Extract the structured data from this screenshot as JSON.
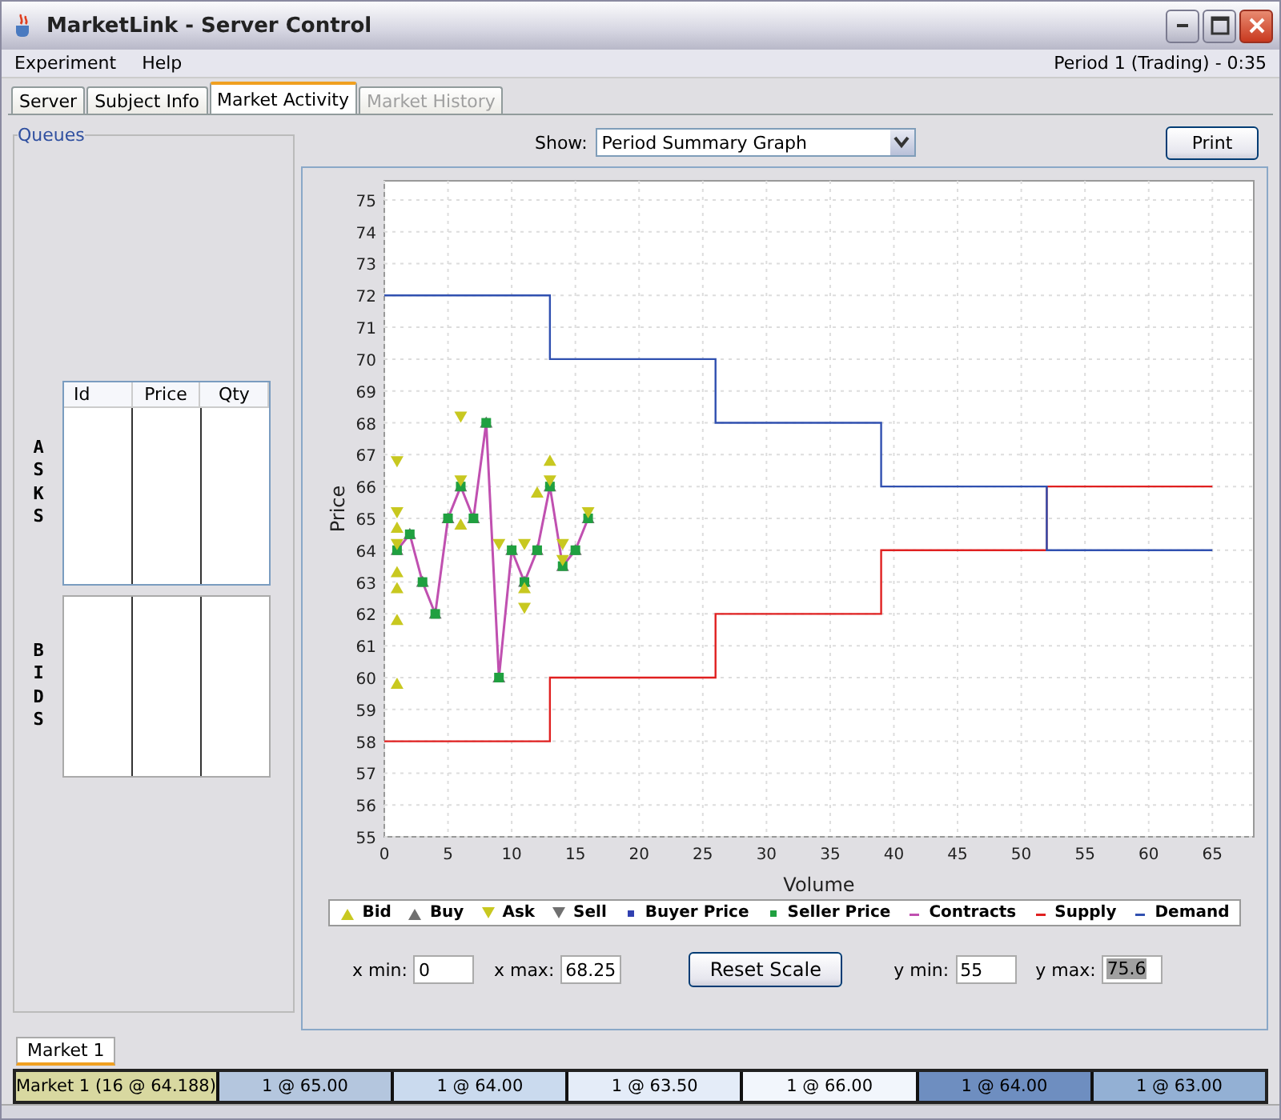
{
  "window": {
    "title": "MarketLink - Server Control"
  },
  "menu": [
    "Experiment",
    "Help"
  ],
  "status": "Period 1 (Trading) - 0:35",
  "tabs": [
    {
      "label": "Server",
      "selected": false,
      "disabled": false
    },
    {
      "label": "Subject Info",
      "selected": false,
      "disabled": false
    },
    {
      "label": "Market Activity",
      "selected": true,
      "disabled": false
    },
    {
      "label": "Market History",
      "selected": false,
      "disabled": true
    }
  ],
  "queues": {
    "title": "Queues",
    "columns": [
      "Id",
      "Price",
      "Qty"
    ],
    "asks_label": "ASKS",
    "bids_label": "BIDS"
  },
  "show": {
    "label": "Show:",
    "value": "Period Summary Graph"
  },
  "print_button": "Print",
  "chart": {
    "chart_data": {
      "type": "line",
      "grid": true,
      "xlabel": "Volume",
      "ylabel": "Price",
      "xlim": [
        0,
        68.25
      ],
      "ylim": [
        55,
        75.6
      ],
      "xticks": [
        0,
        5,
        10,
        15,
        20,
        25,
        30,
        35,
        40,
        45,
        50,
        55,
        60,
        65
      ],
      "yticks": [
        55,
        56,
        57,
        58,
        59,
        60,
        61,
        62,
        63,
        64,
        65,
        66,
        67,
        68,
        69,
        70,
        71,
        72,
        73,
        74,
        75
      ],
      "series": [
        {
          "name": "Supply",
          "color": "#e02020",
          "x": [
            0,
            13,
            13,
            26,
            26,
            39,
            39,
            52,
            52,
            65
          ],
          "values": [
            58,
            58,
            60,
            60,
            62,
            62,
            64,
            64,
            66,
            66
          ]
        },
        {
          "name": "Demand",
          "color": "#3050b0",
          "x": [
            0,
            13,
            13,
            26,
            26,
            39,
            39,
            52,
            52,
            65
          ],
          "values": [
            72,
            72,
            70,
            70,
            68,
            68,
            66,
            66,
            64,
            64
          ]
        },
        {
          "name": "Contracts",
          "color": "#c050b0",
          "marker": "square",
          "x": [
            1,
            2,
            3,
            4,
            5,
            6,
            7,
            8,
            9,
            10,
            11,
            12,
            13,
            14,
            15,
            16
          ],
          "values": [
            64,
            64.5,
            63,
            62,
            65,
            66,
            65,
            68,
            60,
            64,
            63,
            64,
            66,
            63.5,
            64,
            65
          ]
        },
        {
          "name": "Bid",
          "type": "scatter",
          "color": "#c8c820",
          "x": [
            1,
            1,
            1,
            1,
            1,
            6,
            11,
            12,
            13
          ],
          "values": [
            64.7,
            63.3,
            62.8,
            61.8,
            59.8,
            64.8,
            62.8,
            65.8,
            66.8
          ]
        },
        {
          "name": "Ask",
          "type": "scatter",
          "color": "#c8c820",
          "x": [
            1,
            1,
            1,
            6,
            6,
            9,
            11,
            11,
            13,
            14,
            14,
            16
          ],
          "values": [
            66.8,
            65.2,
            64.2,
            68.2,
            66.2,
            64.2,
            64.2,
            62.2,
            66.2,
            64.2,
            63.7,
            65.2
          ]
        }
      ]
    },
    "legend": [
      {
        "kind": "up"
      },
      {
        "label": "Buy",
        "kind": "up",
        "color": "#707070"
      },
      {
        "kind": "down"
      },
      {
        "label": "Sell",
        "kind": "down",
        "color": "#707070"
      },
      {
        "label": "Buyer Price",
        "kind": "square",
        "color": "#3040b0"
      },
      {
        "label": "Seller Price",
        "kind": "square",
        "color": "#20a040"
      },
      {
        "kind": "dash"
      },
      {
        "kind": "dash"
      },
      {
        "kind": "dash"
      }
    ]
  },
  "scale": {
    "x_min": {
      "label": "x min:",
      "value": "0"
    },
    "x_max": {
      "label": "x max:",
      "value": "68.25"
    },
    "reset_button": "Reset Scale",
    "y_min": {
      "label": "y min:",
      "value": "55"
    },
    "y_max": {
      "label": "y max:",
      "value": "75.6",
      "selected": true
    }
  },
  "market_tabs": [
    {
      "label": "Market 1",
      "selected": true
    }
  ],
  "summary": {
    "market": "Market 1 (16 @ 64.188)",
    "trades": [
      {
        "text": "1 @ 65.00",
        "color": "#b4c6de"
      },
      {
        "text": "1 @ 64.00",
        "color": "#cadaee"
      },
      {
        "text": "1 @ 63.50",
        "color": "#e4ecf8"
      },
      {
        "text": "1 @ 66.00",
        "color": "#f2f6fc"
      },
      {
        "text": "1 @ 64.00",
        "color": "#6e8ec0"
      },
      {
        "text": "1 @ 63.00",
        "color": "#93b0d4"
      }
    ]
  }
}
